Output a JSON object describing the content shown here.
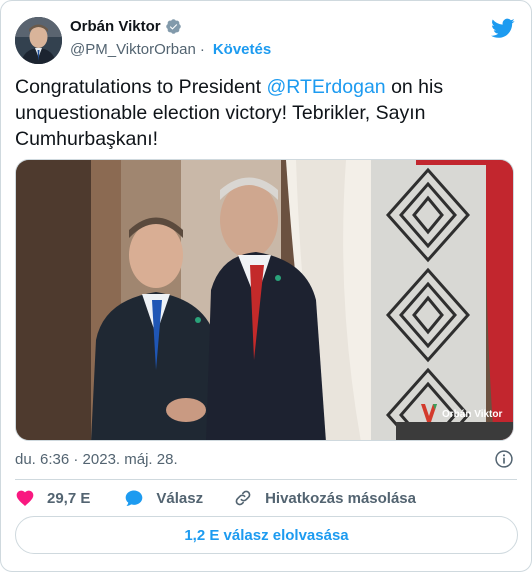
{
  "author": {
    "name": "Orbán Viktor",
    "handle": "@PM_ViktorOrban",
    "separator": "·",
    "follow_label": "Követés"
  },
  "tweet": {
    "text_before": "Congratulations to President ",
    "mention": "@RTErdogan",
    "text_after": " on his unquestionable election victory! Tebrikler, Sayın Cumhurbaşkanı!",
    "image_watermark": "Orbán Viktor",
    "timestamp": "du. 6:36 · 2023. máj. 28."
  },
  "actions": {
    "likes": "29,7 E",
    "reply_label": "Válasz",
    "copy_link_label": "Hivatkozás másolása"
  },
  "read_replies_label": "1,2 E válasz elolvasása",
  "colors": {
    "accent": "#1d9bf0",
    "like": "#f91880",
    "text": "#0f1419",
    "secondary": "#536471",
    "border": "#cfd9de"
  },
  "icons": {
    "verified": "verified-badge-icon",
    "brand": "twitter-bird-icon",
    "info": "info-icon",
    "like": "heart-icon",
    "reply": "speech-bubble-icon",
    "link": "link-icon"
  }
}
